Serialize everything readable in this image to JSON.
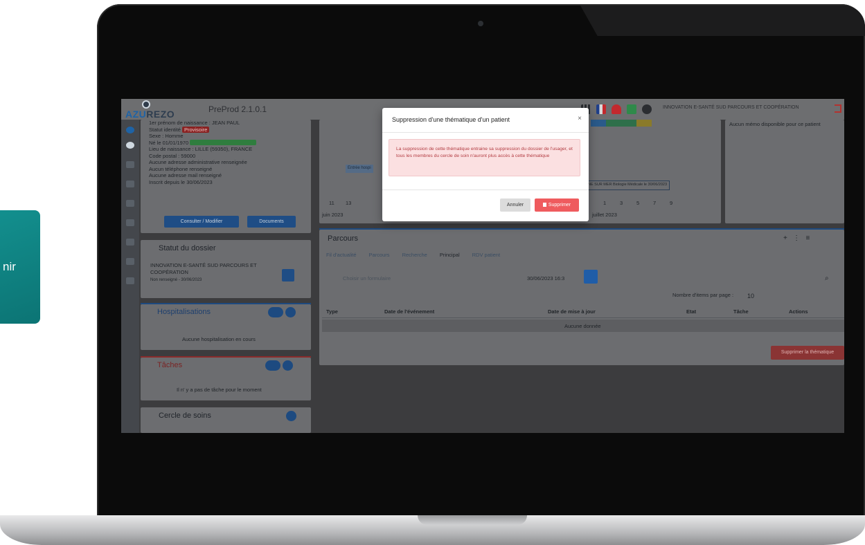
{
  "teal_card": {
    "text": "nir"
  },
  "app": {
    "logo_prefix": "AZU",
    "logo_suffix": "REZO",
    "version": "PreProd 2.1.0.1",
    "user_org": "INNOVATION E-SANTÉ SUD PARCOURS ET COOPÉRATION"
  },
  "patient": {
    "lines": [
      "1er prénom de naissance : JEAN PAUL",
      "Statut identité",
      "Sexe : Homme",
      "Né le 01/01/1970",
      "Lieu de naissance : LILLE (59350), FRANCE",
      "Code postal : 59000",
      "Aucune adresse administrative renseignée",
      "Aucun téléphone renseigné",
      "Aucune adresse mail renseigné",
      "Inscrit depuis le 30/06/2023"
    ],
    "status_badge": "Provisoire",
    "btn_consult": "Consulter / Modifier",
    "btn_documents": "Documents"
  },
  "statut_dossier": {
    "title": "Statut du dossier",
    "org": "INNOVATION E-SANTÉ SUD PARCOURS ET COOPÉRATION",
    "state": "Non renseigné - 30/06/2023"
  },
  "hospitalisations": {
    "title": "Hospitalisations",
    "empty": "Aucune hospitalisation en cours"
  },
  "taches": {
    "title": "Tâches",
    "empty": "Il n' y a pas de tâche pour le moment"
  },
  "cercle": {
    "title": "Cercle de soins"
  },
  "timeline": {
    "ticks_left": [
      "11",
      "13"
    ],
    "ticks_right": [
      "1",
      "3",
      "5",
      "7",
      "9"
    ],
    "month_left": "juin 2023",
    "month_right": "juillet 2023",
    "event": "NE SUR MER Biologie Médicale le 30/06/2023",
    "entry": "Entrée hospi"
  },
  "memo": {
    "text": "Aucun mémo disponible pour ce patient"
  },
  "parcours": {
    "title": "Parcours",
    "tabs": [
      "Fil d'actualité",
      "Parcours",
      "Recherche",
      "Principal",
      "RDV patient"
    ],
    "form_placeholder": "Choisir un formulaire",
    "date_value": "30/06/2023 16:3",
    "items_per_page_label": "Nombre d'items par page :",
    "items_per_page": "10",
    "columns": [
      "Type",
      "Date de l'événement",
      "Date de mise à jour",
      "Etat",
      "Tâche",
      "Actions"
    ],
    "empty": "Aucune donnée",
    "delete_btn": "Supprimer la thématique"
  },
  "modal": {
    "title": "Suppression d'une thématique d'un patient",
    "close": "×",
    "message": "La suppression de cette thématique entraine sa suppression du dossier de l'usager, et tous les membres du cercle de soin n'auront plus accès à cette thématique",
    "cancel": "Annuler",
    "confirm": "Supprimer"
  }
}
